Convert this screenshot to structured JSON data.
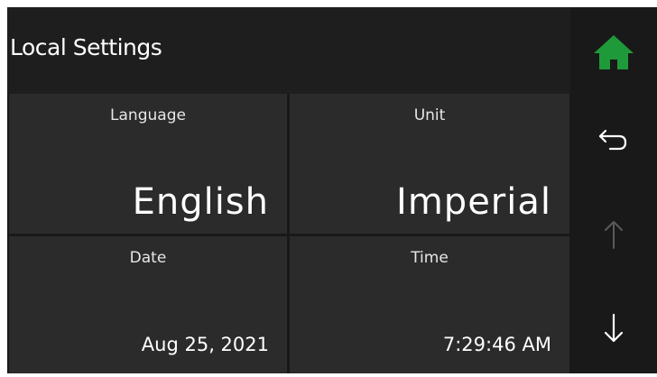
{
  "header": {
    "title": "Local Settings"
  },
  "nav": {
    "home_icon": "home-icon",
    "back_icon": "back-arrow-icon",
    "up_icon": "up-arrow-icon",
    "down_icon": "down-arrow-icon",
    "home_color": "#1f9a3a",
    "up_state": "disabled"
  },
  "settings": {
    "language": {
      "label": "Language",
      "value": "English"
    },
    "unit": {
      "label": "Unit",
      "value": "Imperial"
    },
    "date": {
      "label": "Date",
      "value": "Aug 25, 2021"
    },
    "time": {
      "label": "Time",
      "value": "7:29:46 AM"
    }
  },
  "colors": {
    "background": "#191919",
    "tile": "#2b2b2b",
    "header": "#1e1e1e",
    "text": "#ffffff",
    "disabled": "#5a5a5a"
  }
}
